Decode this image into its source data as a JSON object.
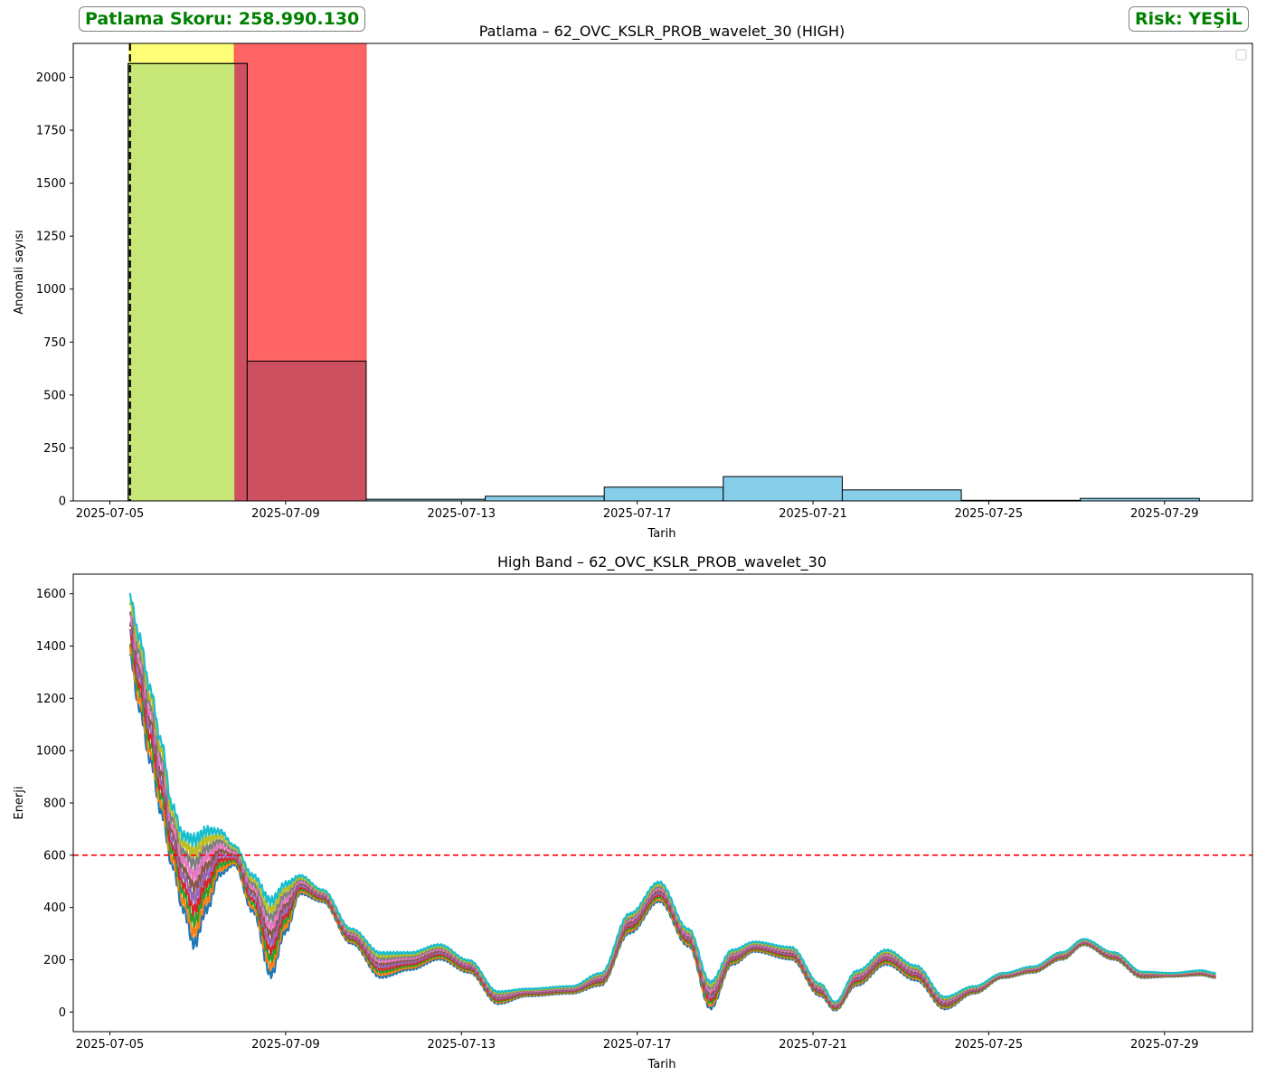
{
  "score_badge": "Patlama Skoru: 258.990.130",
  "risk_badge": "Risk: YEŞİL",
  "colors": {
    "badge_text": "#008000",
    "hist_bar": "#87CEEB",
    "span_yellow": "#FFFF77",
    "span_red": "#FF6464",
    "overlap_green": "#C6E677",
    "overlap_darkred": "#CC5060",
    "threshold": "#FF0000"
  },
  "chart_data": [
    {
      "type": "bar",
      "title": "Patlama – 62_OVC_KSLR_PROB_wavelet_30 (HIGH)",
      "xlabel": "Tarih",
      "ylabel": "Anomali sayısı",
      "xlim": [
        "2025-07-04T04:00",
        "2025-07-31T00:00"
      ],
      "ylim": [
        0,
        2160
      ],
      "x_ticks": [
        "2025-07-05",
        "2025-07-09",
        "2025-07-13",
        "2025-07-17",
        "2025-07-21",
        "2025-07-25",
        "2025-07-29"
      ],
      "y_ticks": [
        0,
        250,
        500,
        750,
        1000,
        1250,
        1500,
        1750,
        2000
      ],
      "bins": [
        {
          "start": "2025-07-05T10:00",
          "end": "2025-07-08T03:00",
          "value": 2065
        },
        {
          "start": "2025-07-08T03:00",
          "end": "2025-07-10T20:00",
          "value": 660
        },
        {
          "start": "2025-07-10T20:00",
          "end": "2025-07-13T13:00",
          "value": 8
        },
        {
          "start": "2025-07-13T13:00",
          "end": "2025-07-16T06:00",
          "value": 22
        },
        {
          "start": "2025-07-16T06:00",
          "end": "2025-07-18T23:00",
          "value": 65
        },
        {
          "start": "2025-07-18T23:00",
          "end": "2025-07-21T16:00",
          "value": 115
        },
        {
          "start": "2025-07-21T16:00",
          "end": "2025-07-24T09:00",
          "value": 52
        },
        {
          "start": "2025-07-24T09:00",
          "end": "2025-07-27T02:00",
          "value": 3
        },
        {
          "start": "2025-07-27T02:00",
          "end": "2025-07-29T19:00",
          "value": 12
        }
      ],
      "spans": [
        {
          "start": "2025-07-05T10:00",
          "end": "2025-07-07T20:00",
          "color": "#FFFF77"
        },
        {
          "start": "2025-07-07T20:00",
          "end": "2025-07-10T20:00",
          "color": "#FF6464"
        }
      ],
      "vline": "2025-07-05T11:00",
      "legend": "top-right",
      "grid": false
    },
    {
      "type": "line",
      "title": "High Band – 62_OVC_KSLR_PROB_wavelet_30",
      "xlabel": "Tarih",
      "ylabel": "Enerji",
      "xlim": [
        "2025-07-04T04:00",
        "2025-07-31T00:00"
      ],
      "ylim": [
        -75,
        1675
      ],
      "x_ticks": [
        "2025-07-05",
        "2025-07-09",
        "2025-07-13",
        "2025-07-17",
        "2025-07-21",
        "2025-07-25",
        "2025-07-29"
      ],
      "y_ticks": [
        0,
        200,
        400,
        600,
        800,
        1000,
        1200,
        1400,
        1600
      ],
      "threshold": 600,
      "series_count": 10,
      "series_colors": [
        "#1f77b4",
        "#ff7f0e",
        "#2ca02c",
        "#d62728",
        "#9467bd",
        "#8c564b",
        "#e377c2",
        "#7f7f7f",
        "#bcbd22",
        "#17becf"
      ],
      "envelope": [
        {
          "x": "2025-07-05T11:00",
          "lo": 1350,
          "hi": 1600
        },
        {
          "x": "2025-07-05T16:00",
          "lo": 1150,
          "hi": 1450
        },
        {
          "x": "2025-07-05T22:00",
          "lo": 950,
          "hi": 1250
        },
        {
          "x": "2025-07-06T04:00",
          "lo": 750,
          "hi": 1050
        },
        {
          "x": "2025-07-06T10:00",
          "lo": 550,
          "hi": 800
        },
        {
          "x": "2025-07-06T16:00",
          "lo": 380,
          "hi": 690
        },
        {
          "x": "2025-07-06T22:00",
          "lo": 240,
          "hi": 680
        },
        {
          "x": "2025-07-07T05:00",
          "lo": 380,
          "hi": 710
        },
        {
          "x": "2025-07-07T12:00",
          "lo": 520,
          "hi": 700
        },
        {
          "x": "2025-07-07T20:00",
          "lo": 560,
          "hi": 640
        },
        {
          "x": "2025-07-08T06:00",
          "lo": 380,
          "hi": 530
        },
        {
          "x": "2025-07-08T16:00",
          "lo": 130,
          "hi": 440
        },
        {
          "x": "2025-07-09T00:00",
          "lo": 300,
          "hi": 500
        },
        {
          "x": "2025-07-09T08:00",
          "lo": 450,
          "hi": 525
        },
        {
          "x": "2025-07-09T20:00",
          "lo": 420,
          "hi": 470
        },
        {
          "x": "2025-07-10T12:00",
          "lo": 260,
          "hi": 320
        },
        {
          "x": "2025-07-11T04:00",
          "lo": 130,
          "hi": 230
        },
        {
          "x": "2025-07-11T20:00",
          "lo": 160,
          "hi": 230
        },
        {
          "x": "2025-07-12T12:00",
          "lo": 200,
          "hi": 260
        },
        {
          "x": "2025-07-13T04:00",
          "lo": 150,
          "hi": 200
        },
        {
          "x": "2025-07-13T20:00",
          "lo": 30,
          "hi": 80
        },
        {
          "x": "2025-07-14T12:00",
          "lo": 60,
          "hi": 90
        },
        {
          "x": "2025-07-15T12:00",
          "lo": 70,
          "hi": 100
        },
        {
          "x": "2025-07-16T04:00",
          "lo": 100,
          "hi": 150
        },
        {
          "x": "2025-07-16T20:00",
          "lo": 300,
          "hi": 380
        },
        {
          "x": "2025-07-17T12:00",
          "lo": 420,
          "hi": 500
        },
        {
          "x": "2025-07-18T04:00",
          "lo": 250,
          "hi": 320
        },
        {
          "x": "2025-07-18T16:00",
          "lo": 10,
          "hi": 120
        },
        {
          "x": "2025-07-19T04:00",
          "lo": 180,
          "hi": 240
        },
        {
          "x": "2025-07-19T16:00",
          "lo": 230,
          "hi": 270
        },
        {
          "x": "2025-07-20T12:00",
          "lo": 200,
          "hi": 250
        },
        {
          "x": "2025-07-21T04:00",
          "lo": 60,
          "hi": 110
        },
        {
          "x": "2025-07-21T12:00",
          "lo": 5,
          "hi": 40
        },
        {
          "x": "2025-07-22T00:00",
          "lo": 100,
          "hi": 160
        },
        {
          "x": "2025-07-22T16:00",
          "lo": 180,
          "hi": 240
        },
        {
          "x": "2025-07-23T08:00",
          "lo": 120,
          "hi": 180
        },
        {
          "x": "2025-07-24T00:00",
          "lo": 10,
          "hi": 60
        },
        {
          "x": "2025-07-24T16:00",
          "lo": 70,
          "hi": 100
        },
        {
          "x": "2025-07-25T08:00",
          "lo": 130,
          "hi": 150
        },
        {
          "x": "2025-07-26T00:00",
          "lo": 150,
          "hi": 175
        },
        {
          "x": "2025-07-26T16:00",
          "lo": 200,
          "hi": 230
        },
        {
          "x": "2025-07-27T04:00",
          "lo": 255,
          "hi": 280
        },
        {
          "x": "2025-07-27T20:00",
          "lo": 200,
          "hi": 230
        },
        {
          "x": "2025-07-28T12:00",
          "lo": 130,
          "hi": 155
        },
        {
          "x": "2025-07-29T04:00",
          "lo": 135,
          "hi": 150
        },
        {
          "x": "2025-07-29T20:00",
          "lo": 140,
          "hi": 160
        },
        {
          "x": "2025-07-30T04:00",
          "lo": 130,
          "hi": 150
        }
      ]
    }
  ]
}
